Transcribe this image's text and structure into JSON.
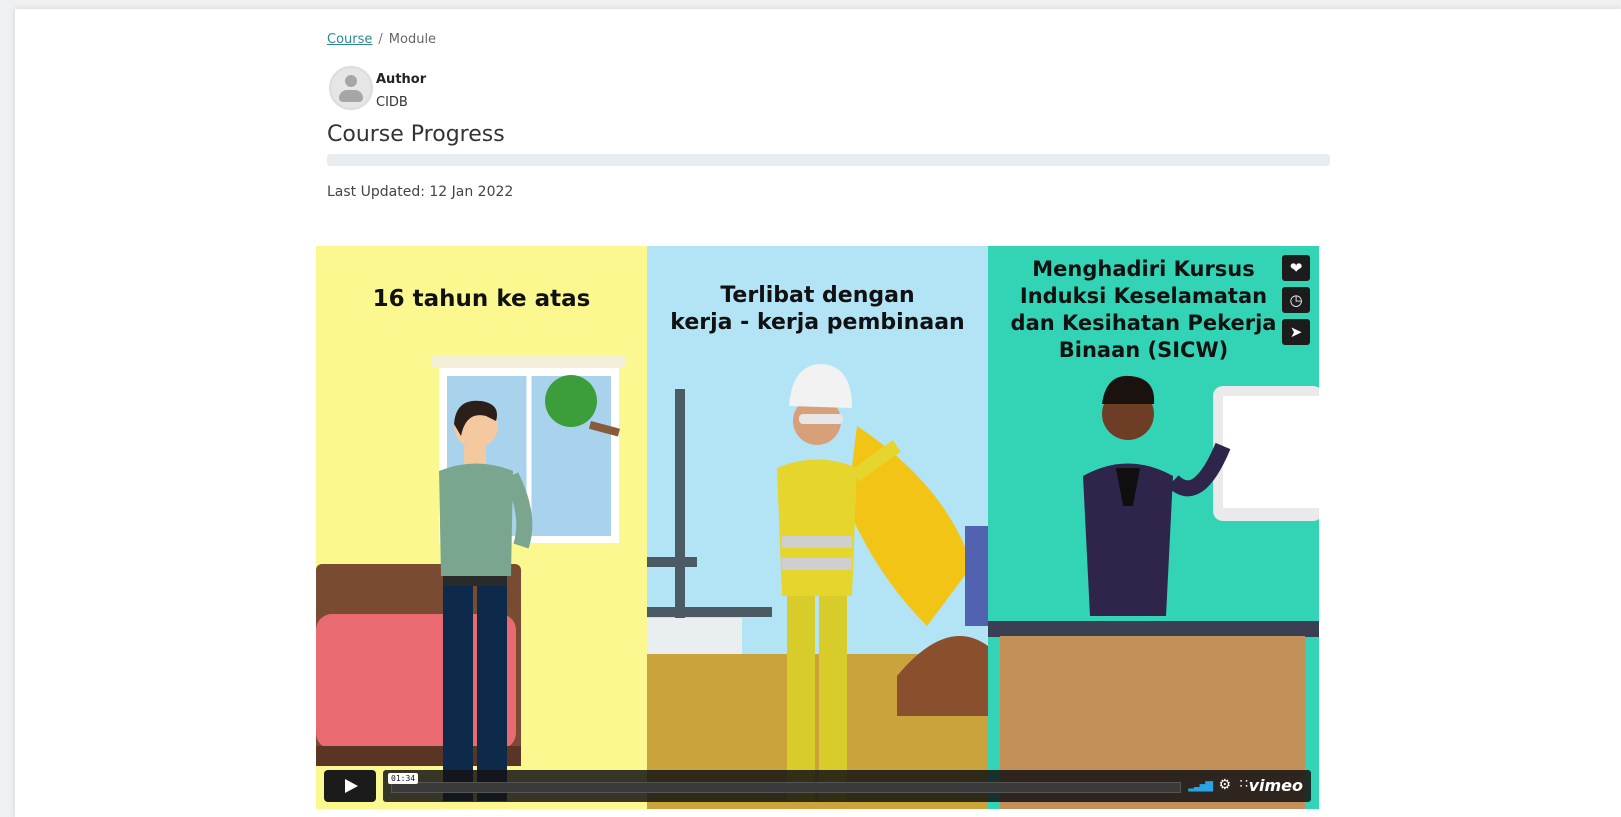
{
  "breadcrumb": {
    "course": "Course",
    "separator": "/",
    "current": "Module"
  },
  "author": {
    "label": "Author",
    "name": "CIDB"
  },
  "progress": {
    "title": "Course Progress",
    "percent": 0
  },
  "updated": "Last Updated: 12 Jan 2022",
  "video": {
    "panels": [
      {
        "title": "16 tahun ke atas"
      },
      {
        "title": "Terlibat dengan\nkerja - kerja pembinaan"
      },
      {
        "title": "Menghadiri Kursus\nInduksi Keselamatan\ndan Kesihatan Pekerja\nBinaan  (SICW)"
      }
    ],
    "side_icons": [
      "heart-icon",
      "clock-icon",
      "send-icon"
    ],
    "controls": {
      "time": "01:34",
      "brand": "vimeo",
      "volume_icon": "volume-icon",
      "settings_icon": "gear-icon",
      "fullscreen_icon": "fullscreen-icon"
    }
  }
}
